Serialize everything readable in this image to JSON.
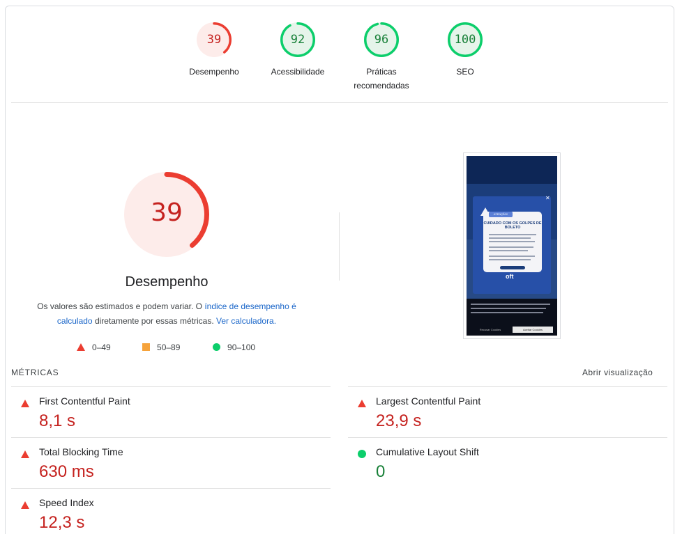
{
  "categories": [
    {
      "label": "Desempenho",
      "score": "39",
      "level": 0.39,
      "status": "fail"
    },
    {
      "label": "Acessibilidade",
      "score": "92",
      "level": 0.92,
      "status": "pass"
    },
    {
      "label": "Práticas recomendadas",
      "score": "96",
      "level": 0.96,
      "status": "pass"
    },
    {
      "label": "SEO",
      "score": "100",
      "level": 1.0,
      "status": "pass"
    }
  ],
  "performance": {
    "score": "39",
    "level": 0.39,
    "title": "Desempenho",
    "desc_prefix": "Os valores são estimados e podem variar. O ",
    "desc_link1": "índice de desempenho é calculado",
    "desc_middle": " diretamente por essas métricas. ",
    "desc_link2": "Ver calculadora.",
    "legend": {
      "fail": "0–49",
      "average": "50–89",
      "pass": "90–100"
    }
  },
  "screenshot": {
    "modal_badge": "ATENÇÃO!",
    "modal_title": "CUIDADO COM OS GOLPES DE BOLETO",
    "logo": "oft",
    "cookie_reject": "Recusar Cookies",
    "cookie_accept": "Aceitar Cookies"
  },
  "metrics": {
    "header": "MÉTRICAS",
    "open_view": "Abrir visualização",
    "items": [
      {
        "name": "First Contentful Paint",
        "value": "8,1 s",
        "status": "fail"
      },
      {
        "name": "Largest Contentful Paint",
        "value": "23,9 s",
        "status": "fail"
      },
      {
        "name": "Total Blocking Time",
        "value": "630 ms",
        "status": "fail"
      },
      {
        "name": "Cumulative Layout Shift",
        "value": "0",
        "status": "pass"
      },
      {
        "name": "Speed Index",
        "value": "12,3 s",
        "status": "fail"
      }
    ]
  },
  "colors": {
    "fail": "#eb3d31",
    "fail_text": "#c5221f",
    "fail_bg": "#fdecea",
    "average": "#f6a33b",
    "pass": "#0cce6b",
    "pass_text": "#188038",
    "pass_bg": "#e6f4ea",
    "link": "#1a66c9"
  }
}
